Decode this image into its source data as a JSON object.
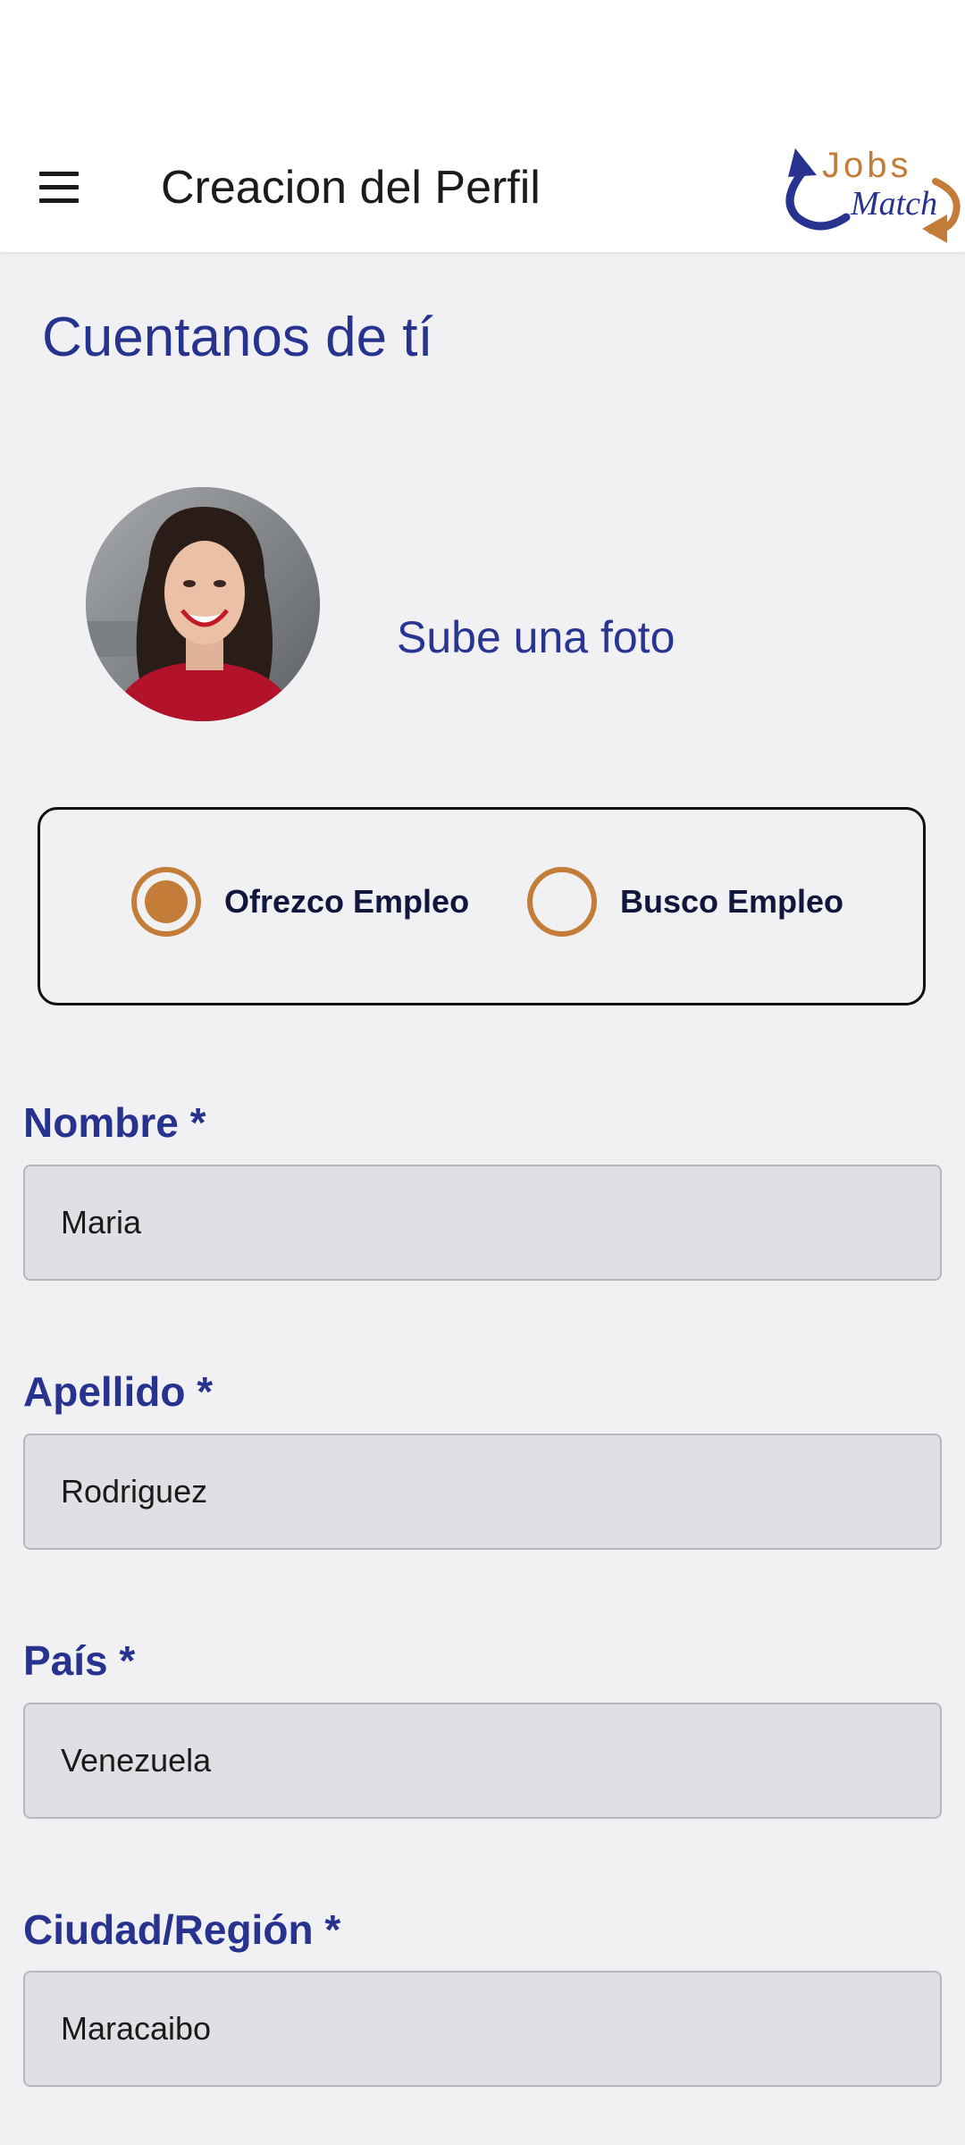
{
  "appbar": {
    "title": "Creacion del Perfil",
    "menu_icon": "hamburger-menu-icon",
    "logo": {
      "word1": "Jobs",
      "word2": "Match"
    }
  },
  "profile": {
    "heading": "Cuentanos de tí",
    "upload_label": "Sube una foto"
  },
  "role": {
    "options": [
      {
        "label": "Ofrezco Empleo",
        "checked": true
      },
      {
        "label": "Busco Empleo",
        "checked": false
      }
    ]
  },
  "fields": [
    {
      "label": "Nombre *",
      "value": "Maria"
    },
    {
      "label": "Apellido *",
      "value": "Rodriguez"
    },
    {
      "label": "País *",
      "value": "Venezuela"
    },
    {
      "label": "Ciudad/Región *",
      "value": "Maracaibo"
    }
  ],
  "colors": {
    "primary": "#27338f",
    "accent": "#c47d38",
    "background": "#f1f0f2",
    "input_bg": "#dfdfe4"
  }
}
